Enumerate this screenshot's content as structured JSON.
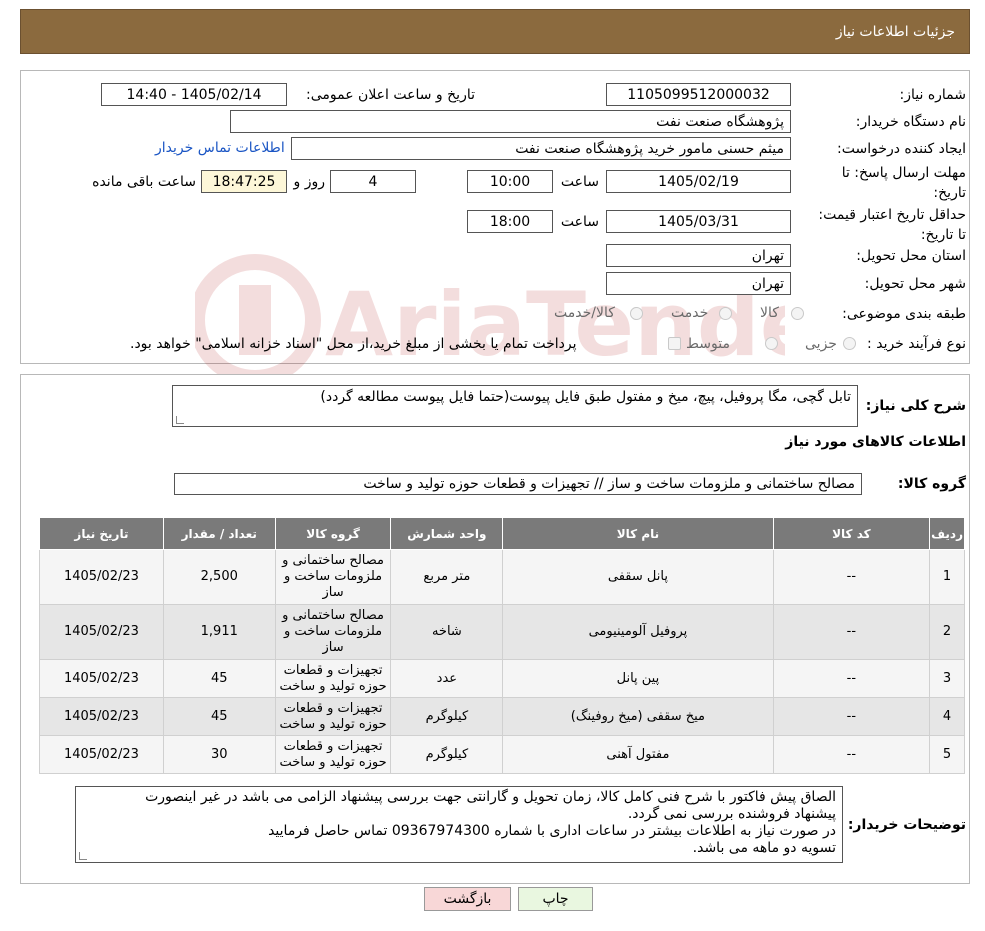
{
  "header": {
    "title": "جزئیات اطلاعات نیاز"
  },
  "form": {
    "need_number": {
      "label": "شماره نیاز:",
      "value": "1105099512000032"
    },
    "announce_datetime": {
      "label": "تاریخ و ساعت اعلان عمومی:",
      "value": "1405/02/14 - 14:40"
    },
    "buyer_org": {
      "label": "نام دستگاه خریدار:",
      "value": "پژوهشگاه صنعت نفت"
    },
    "requester": {
      "label": "ایجاد کننده درخواست:",
      "value": "میثم حسنی مامور خرید پژوهشگاه صنعت نفت",
      "contact_link": "اطلاعات تماس خریدار"
    },
    "reply_deadline": {
      "label": "مهلت ارسال پاسخ: تا تاریخ:",
      "date": "1405/02/19",
      "time_label": "ساعت",
      "time": "10:00",
      "days": "4",
      "days_label": "روز و",
      "remaining": "18:47:25",
      "remaining_label": "ساعت باقی مانده"
    },
    "price_validity": {
      "label": "حداقل تاریخ اعتبار قیمت: تا تاریخ:",
      "date": "1405/03/31",
      "time_label": "ساعت",
      "time": "18:00"
    },
    "delivery_province": {
      "label": "استان محل تحویل:",
      "value": "تهران"
    },
    "delivery_city": {
      "label": "شهر محل تحویل:",
      "value": "تهران"
    },
    "category": {
      "label": "طبقه بندی موضوعی:",
      "options": [
        "کالا",
        "خدمت",
        "کالا/خدمت"
      ]
    },
    "purchase_process": {
      "label": "نوع فرآیند خرید :",
      "options": [
        "جزیی",
        "متوسط"
      ],
      "note": "پرداخت تمام یا بخشی از مبلغ خرید،از محل \"اسناد خزانه اسلامی\" خواهد بود."
    }
  },
  "summary": {
    "label": "شرح کلی نیاز:",
    "value": "تابل گچی، مگا پروفیل، پیچ، میخ و مفتول طبق فایل پیوست(حتما فایل پیوست مطالعه گردد)",
    "items_title": "اطلاعات کالاهای مورد نیاز",
    "group_label": "گروه کالا:",
    "group_value": "مصالح ساختمانی و ملزومات ساخت و ساز // تجهیزات و قطعات حوزه تولید و ساخت"
  },
  "table": {
    "headers": [
      "ردیف",
      "کد کالا",
      "نام کالا",
      "واحد شمارش",
      "گروه کالا",
      "تعداد / مقدار",
      "تاریخ نیاز"
    ],
    "rows": [
      [
        "1",
        "--",
        "پانل سقفی",
        "متر مربع",
        "مصالح ساختمانی و ملزومات ساخت و ساز",
        "2,500",
        "1405/02/23"
      ],
      [
        "2",
        "--",
        "پروفیل آلومینیومی",
        "شاخه",
        "مصالح ساختمانی و ملزومات ساخت و ساز",
        "1,911",
        "1405/02/23"
      ],
      [
        "3",
        "--",
        "پین پانل",
        "عدد",
        "تجهیزات و قطعات حوزه تولید و ساخت",
        "45",
        "1405/02/23"
      ],
      [
        "4",
        "--",
        "میخ سقفی (میخ روفینگ)",
        "کیلوگرم",
        "تجهیزات و قطعات حوزه تولید و ساخت",
        "45",
        "1405/02/23"
      ],
      [
        "5",
        "--",
        "مفتول آهنی",
        "کیلوگرم",
        "تجهیزات و قطعات حوزه تولید و ساخت",
        "30",
        "1405/02/23"
      ]
    ]
  },
  "buyer_notes": {
    "label": "توضیحات خریدار:",
    "lines": [
      "الصاق پیش فاکتور با شرح فنی کامل کالا، زمان تحویل و گارانتی جهت بررسی پیشنهاد الزامی می باشد در غیر اینصورت",
      "پیشنهاد فروشنده بررسی نمی گردد.",
      "در صورت نیاز به اطلاعات بیشتر در ساعات اداری با شماره 09367974300 تماس حاصل فرمایید",
      "تسویه دو ماهه می باشد."
    ]
  },
  "buttons": {
    "print": "چاپ",
    "back": "بازگشت"
  },
  "watermark": {
    "text": "AriaTender.neT"
  },
  "colors": {
    "header_bg": "#8b6a3e",
    "link": "#1a55c4",
    "table_header": "#7a7a7a",
    "back_button": "#f8d7d7",
    "print_button": "#e9f7e0"
  }
}
